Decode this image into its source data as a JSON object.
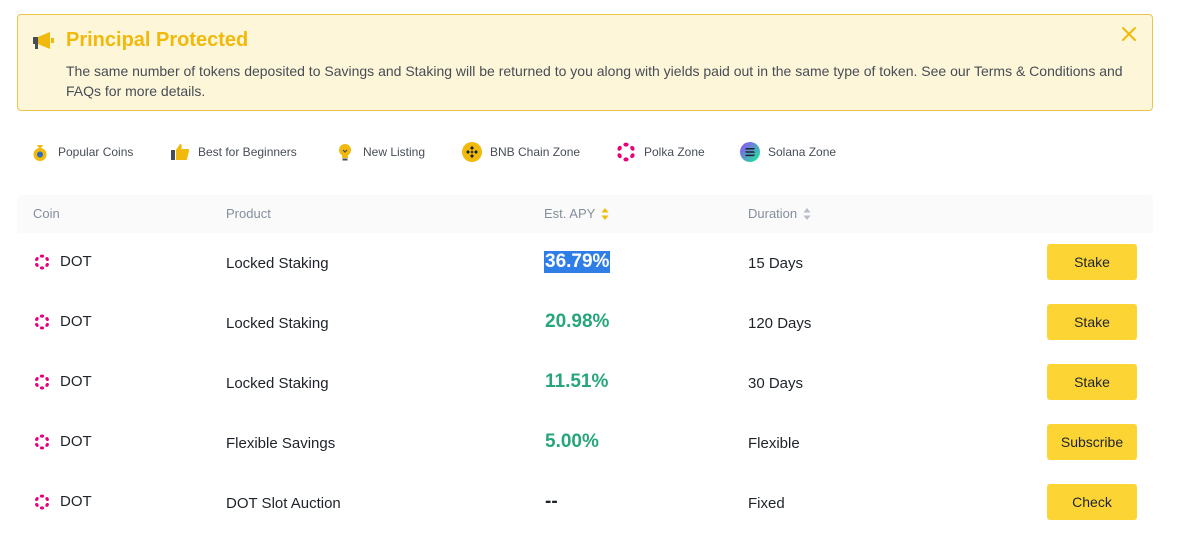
{
  "banner": {
    "title": "Principal Protected",
    "text": "The same number of tokens deposited to Savings and Staking will be returned to you along with yields paid out in the same type of token. See our Terms & Conditions and FAQs for more details.",
    "icon": "megaphone-icon",
    "close_icon": "close-icon"
  },
  "filters": [
    {
      "label": "Popular Coins",
      "icon": "coin-bag-icon"
    },
    {
      "label": "Best for Beginners",
      "icon": "thumbs-up-icon"
    },
    {
      "label": "New Listing",
      "icon": "lightbulb-icon"
    },
    {
      "label": "BNB Chain Zone",
      "icon": "bnb-icon"
    },
    {
      "label": "Polka Zone",
      "icon": "polkadot-icon"
    },
    {
      "label": "Solana Zone",
      "icon": "solana-icon"
    }
  ],
  "table": {
    "headers": {
      "coin": "Coin",
      "product": "Product",
      "apy": "Est. APY",
      "duration": "Duration"
    },
    "rows": [
      {
        "coin": "DOT",
        "product": "Locked Staking",
        "apy": "36.79%",
        "duration": "15 Days",
        "action": "Stake"
      },
      {
        "coin": "DOT",
        "product": "Locked Staking",
        "apy": "20.98%",
        "duration": "120 Days",
        "action": "Stake"
      },
      {
        "coin": "DOT",
        "product": "Locked Staking",
        "apy": "11.51%",
        "duration": "30 Days",
        "action": "Stake"
      },
      {
        "coin": "DOT",
        "product": "Flexible Savings",
        "apy": "5.00%",
        "duration": "Flexible",
        "action": "Subscribe"
      },
      {
        "coin": "DOT",
        "product": "DOT Slot Auction",
        "apy": "--",
        "duration": "Fixed",
        "action": "Check"
      }
    ]
  },
  "colors": {
    "brand_yellow": "#fcd535",
    "apy_green": "#27a57b",
    "polka_pink": "#e6007a",
    "selection_blue": "#2f7ee8"
  }
}
